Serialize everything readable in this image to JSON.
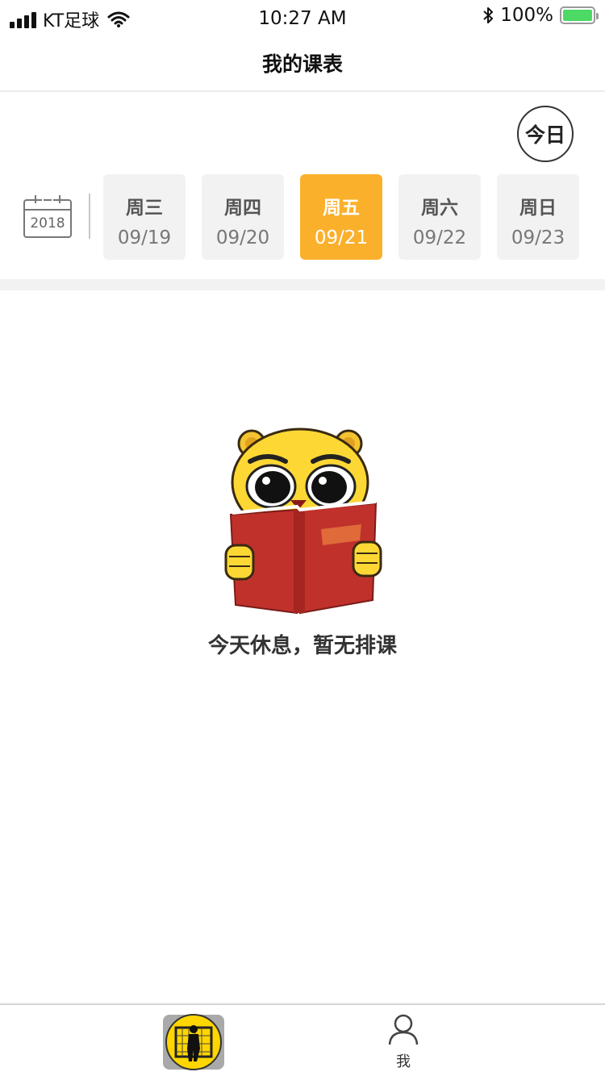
{
  "status_bar": {
    "carrier": "KT足球",
    "time": "10:27 AM",
    "battery": "100%"
  },
  "nav": {
    "title": "我的课表"
  },
  "today_button": "今日",
  "calendar": {
    "year": "2018"
  },
  "days": [
    {
      "weekday": "周三",
      "date": "09/19",
      "active": false
    },
    {
      "weekday": "周四",
      "date": "09/20",
      "active": false
    },
    {
      "weekday": "周五",
      "date": "09/21",
      "active": true
    },
    {
      "weekday": "周六",
      "date": "09/22",
      "active": false
    },
    {
      "weekday": "周日",
      "date": "09/23",
      "active": false
    }
  ],
  "empty_state": {
    "message": "今天休息，暂无排课"
  },
  "tab_bar": {
    "tabs": [
      {
        "icon": "goalkeeper-icon",
        "label": ""
      },
      {
        "icon": "person-icon",
        "label": "我"
      }
    ]
  },
  "colors": {
    "accent": "#fbb02c",
    "card_bg": "#f2f2f2",
    "battery": "#4cd964"
  }
}
